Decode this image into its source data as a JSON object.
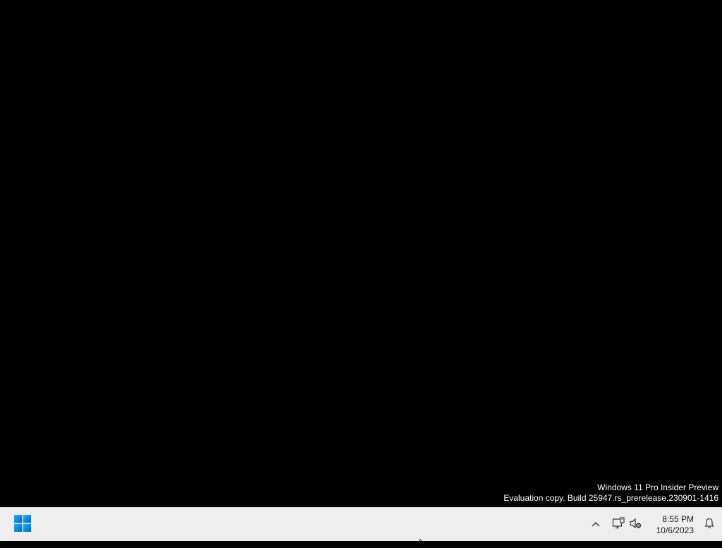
{
  "watermark": {
    "line1": "Windows 11 Pro Insider Preview",
    "line2": "Evaluation copy. Build 25947.rs_prerelease.230901-1416"
  },
  "taskbar": {
    "start_icon": "windows-logo-icon",
    "tray": {
      "chevron_icon": "chevron-up-icon",
      "network_icon": "network-icon",
      "volume_icon": "volume-muted-icon",
      "time": "8:55 PM",
      "date": "10/6/2023",
      "notification_icon": "bell-icon"
    }
  },
  "colors": {
    "desktop_bg": "#000000",
    "taskbar_bg": "#eeeeee",
    "start_blue": "#0a84d6",
    "text_dark": "#1a1a1a"
  }
}
